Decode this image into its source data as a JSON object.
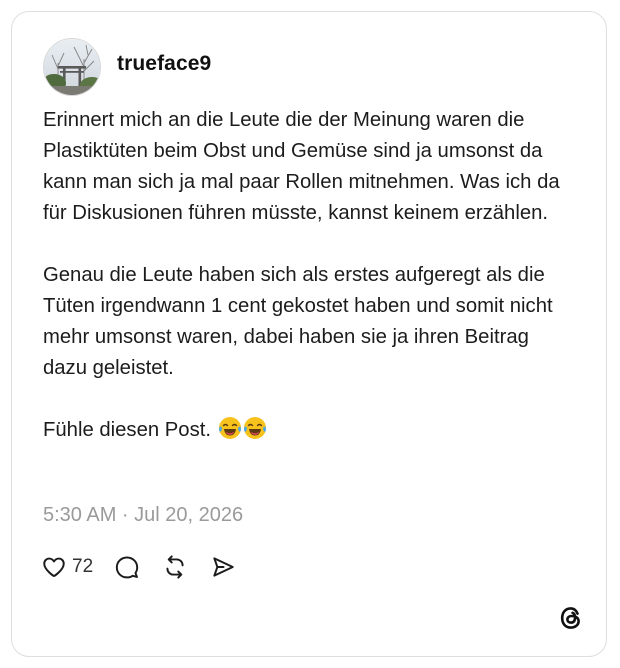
{
  "post": {
    "username": "trueface9",
    "paragraphs": [
      "Erinnert mich an die Leute die der Meinung waren die Plastiktüten beim Obst und Gemüse sind ja umsonst da kann man sich ja mal paar Rollen mitnehmen. Was ich da für Diskusionen führen müsste, kannst keinem erzählen.",
      "Genau die Leute haben sich als erstes aufgeregt als die Tüten irgendwann 1 cent gekostet haben und somit nicht mehr umsonst waren, dabei haben sie ja ihren Beitrag dazu geleistet."
    ],
    "closing_line": "Fühle diesen Post.",
    "emojis": [
      "face-with-tears-of-joy",
      "face-with-tears-of-joy"
    ],
    "timestamp": "5:30 AM · Jul 20, 2026"
  },
  "actions": {
    "like_count": "72",
    "icons": [
      "heart-icon",
      "comment-icon",
      "repost-icon",
      "share-icon"
    ]
  },
  "brand": {
    "logo_icon": "threads-logo-icon"
  }
}
